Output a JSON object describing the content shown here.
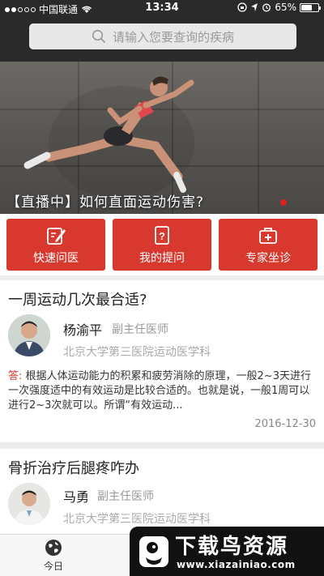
{
  "status_bar": {
    "carrier": "中国联通",
    "time": "13:34",
    "battery": "65%",
    "battery_level": 0.65,
    "icons": [
      "signal-dots",
      "wifi-icon",
      "lock-rotation-icon",
      "location-icon",
      "alarm-icon",
      "battery-icon"
    ]
  },
  "search": {
    "placeholder": "请输入您要查询的疾病",
    "icon": "search-icon"
  },
  "banner": {
    "caption": "【直播中】如何直面运动伤害?"
  },
  "quick_actions": [
    {
      "label": "快速问医",
      "icon": "edit-note-icon"
    },
    {
      "label": "我的提问",
      "icon": "question-doc-icon"
    },
    {
      "label": "专家坐诊",
      "icon": "medical-kit-icon"
    }
  ],
  "articles": [
    {
      "question": "一周运动几次最合适?",
      "doctor_name": "杨渝平",
      "doctor_title": "副主任医师",
      "hospital": "北京大学第三医院运动医学科",
      "answer_label": "答:",
      "answer": "根据人体运动能力的积累和疲劳消除的原理，一般2~3天进行一次强度适中的有效运动是比较合适的。也就是说，一般1周可以进行2~3次就可以。所谓“有效运动...",
      "date": "2016-12-30"
    },
    {
      "question": "骨折治疗后腿疼咋办",
      "doctor_name": "马勇",
      "doctor_title": "副主任医师",
      "hospital": "北京大学第三医院运动医学科"
    }
  ],
  "tabbar": {
    "today_label": "今日",
    "today_icon": "globe-icon"
  },
  "watermark": {
    "brand": "下载鸟资源",
    "url": "www.xiazainiao.com"
  },
  "colors": {
    "accent": "#d9382f",
    "header": "#2a2a2a"
  }
}
